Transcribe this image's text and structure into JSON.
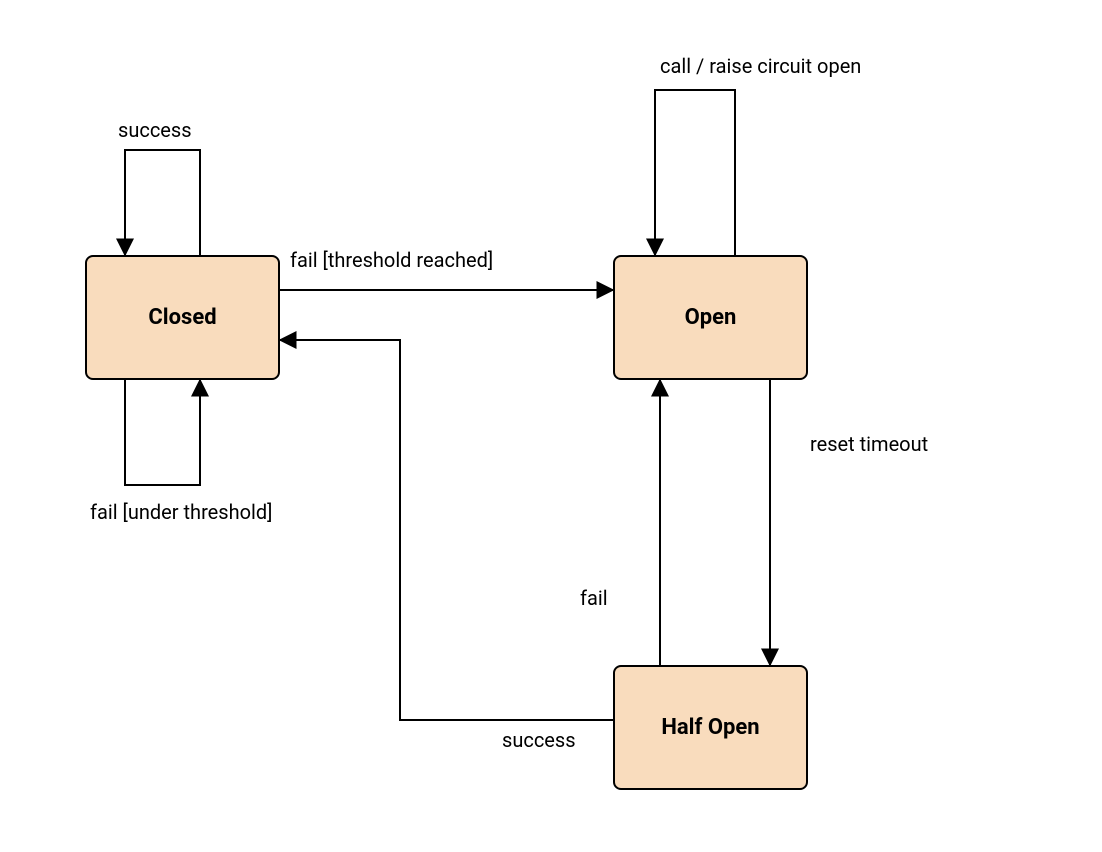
{
  "states": {
    "closed": {
      "label": "Closed"
    },
    "open": {
      "label": "Open"
    },
    "half_open": {
      "label": "Half Open"
    }
  },
  "edges": {
    "closed_self_success": {
      "label": "success"
    },
    "closed_self_fail_under": {
      "label": "fail [under threshold]"
    },
    "closed_to_open": {
      "label": "fail [threshold reached]"
    },
    "open_self_call": {
      "label": "call / raise circuit open"
    },
    "open_to_halfopen": {
      "label": "reset timeout"
    },
    "halfopen_to_open": {
      "label": "fail"
    },
    "halfopen_to_closed": {
      "label": "success"
    }
  },
  "colors": {
    "state_fill": "#f9dcbd",
    "stroke": "#000000"
  }
}
